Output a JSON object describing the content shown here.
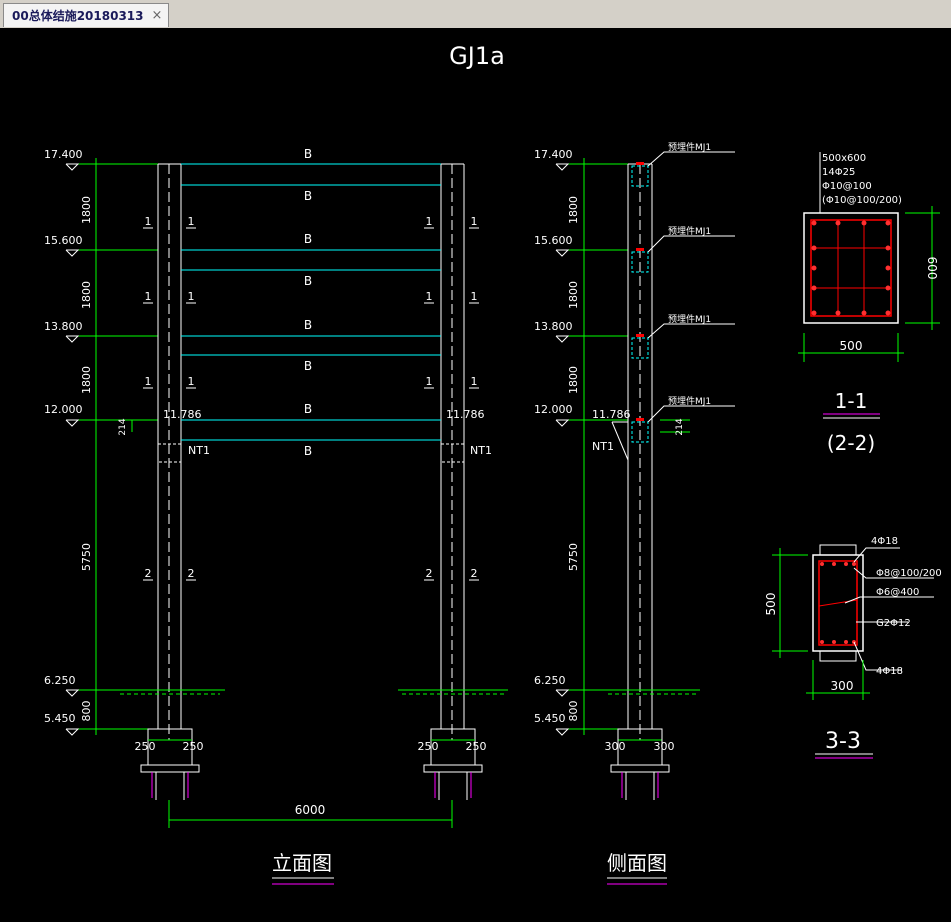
{
  "tab": {
    "title": "00总体结施20180313",
    "close": "×"
  },
  "drawing": {
    "title": "GJ1a",
    "elevation_labels": [
      "17.400",
      "15.600",
      "13.800",
      "12.000",
      "6.250",
      "5.450"
    ],
    "elev_11786": "11.786",
    "dim_1800": "1800",
    "dim_5750": "5750",
    "dim_800": "800",
    "dim_214": "214",
    "dim_250": "250",
    "dim_300": "300",
    "dim_6000": "6000",
    "dim_500": "500",
    "dim_600": "600",
    "beam_label": "B",
    "nt_label": "NT1",
    "sec_1": "1",
    "sec_2": "2",
    "mj_label": "预埋件MJ1",
    "front_view_title": "立面图",
    "side_view_title": "侧面图",
    "section_11": {
      "size": "500x600",
      "main_bars": "14Φ25",
      "stirrup1": "Φ10@100",
      "stirrup2": "(Φ10@100/200)",
      "label": "1-1",
      "label2": "(2-2)"
    },
    "section_33": {
      "top_bars": "4Φ18",
      "stirrup": "Φ8@100/200",
      "tie": "Φ6@400",
      "g2": "G2Φ12",
      "bot_bars": "4Φ18",
      "label": "3-3"
    }
  }
}
